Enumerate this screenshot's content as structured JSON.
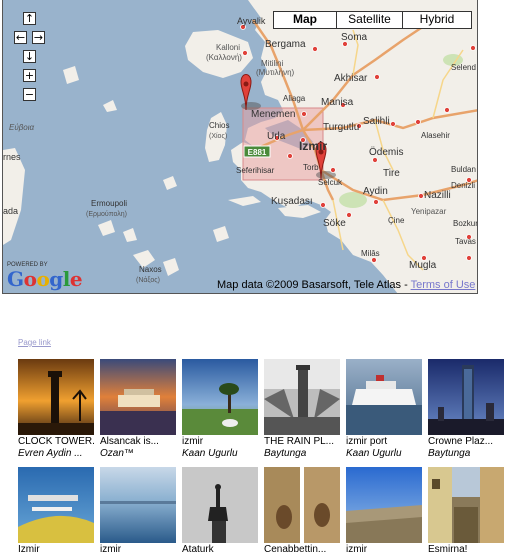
{
  "map": {
    "type_buttons": [
      "Map",
      "Satellite",
      "Hybrid"
    ],
    "selected_type": "Map",
    "controls": {
      "up": "↑",
      "left": "←",
      "right": "→",
      "down": "↓",
      "zoom_in": "+",
      "zoom_out": "−"
    },
    "powered_by": "POWERED BY",
    "logo": "Google",
    "attribution": "Map data ©2009 Basarsoft, Tele Atlas - ",
    "terms": "Terms of Use",
    "highway_shield": "E881",
    "place_labels": [
      "Ayvalik",
      "Kalloni",
      "(Καλλονή)",
      "Bergama",
      "Soma",
      "Mitilini",
      "(Μυτιλήνη)",
      "Akhisar",
      "Aliaga",
      "Manisa",
      "Menemen",
      "Turgutlu",
      "Salihli",
      "Chios",
      "(Χίος)",
      "Urla",
      "Izmir",
      "Ödemis",
      "Seferihisar",
      "Torb",
      "Selcuk",
      "Tire",
      "Aydin",
      "Nazilli",
      "Kuşadası",
      "Söke",
      "Çine",
      "Yenipazar",
      "Milâs",
      "Mugla",
      "Ermoupoli",
      "(Ερμούπολη)",
      "Naxos",
      "(Νάξος)",
      "Εύβοια",
      "rnes",
      "ada",
      "Selend",
      "Alasehir",
      "Buldan",
      "Denizli",
      "Bozkurt",
      "Tavas"
    ]
  },
  "page_link": "Page link",
  "photos": [
    {
      "title": "CLOCK TOWER...",
      "author": "Evren Aydin ..."
    },
    {
      "title": "Alsancak is...",
      "author": "Ozan™"
    },
    {
      "title": "izmir",
      "author": "Kaan Ugurlu"
    },
    {
      "title": "THE RAIN PL...",
      "author": "Baytunga"
    },
    {
      "title": "izmir port",
      "author": "Kaan Ugurlu"
    },
    {
      "title": "Crowne Plaz...",
      "author": "Baytunga"
    },
    {
      "title": "İzmir",
      "author": ""
    },
    {
      "title": "izmir",
      "author": ""
    },
    {
      "title": "Ataturk",
      "author": ""
    },
    {
      "title": "Cenabbettin...",
      "author": ""
    },
    {
      "title": "izmir",
      "author": ""
    },
    {
      "title": "Esmirna!",
      "author": ""
    }
  ],
  "colors": {
    "sea": "#99b3cc",
    "land": "#f2efe9",
    "highway": "#e8a36b",
    "marker": "#e0413a",
    "link": "#9999cc"
  }
}
